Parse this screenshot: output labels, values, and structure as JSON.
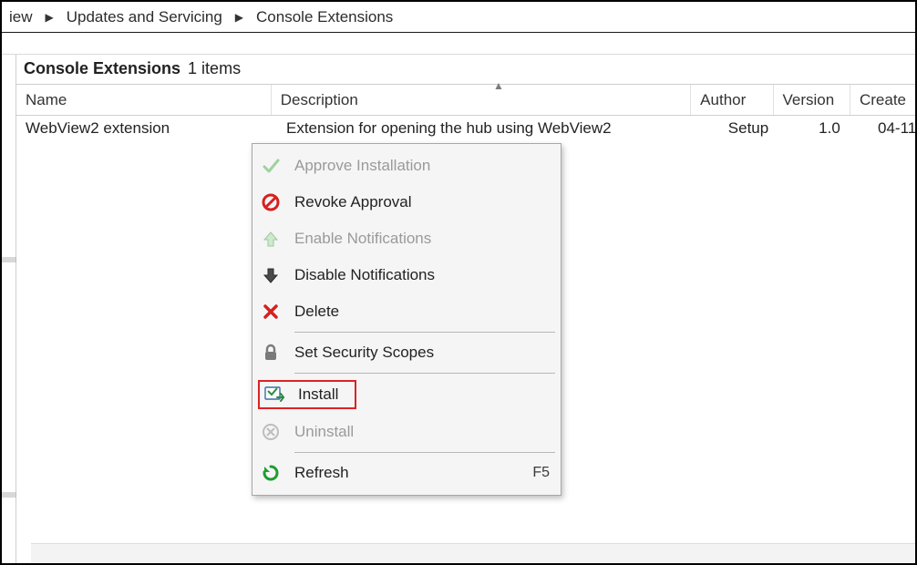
{
  "breadcrumb": {
    "item0": "iew",
    "item1": "Updates and Servicing",
    "item2": "Console Extensions"
  },
  "list": {
    "title": "Console Extensions",
    "count_text": "1 items"
  },
  "columns": {
    "name": "Name",
    "description": "Description",
    "author": "Author",
    "version": "Version",
    "created": "Create"
  },
  "row": {
    "name": "WebView2 extension",
    "description": "Extension for opening the hub using WebView2",
    "author": "Setup",
    "version": "1.0",
    "created": "04-11"
  },
  "menu": {
    "approve": "Approve Installation",
    "revoke": "Revoke Approval",
    "enable_notif": "Enable Notifications",
    "disable_notif": "Disable Notifications",
    "delete": "Delete",
    "security": "Set Security Scopes",
    "install": "Install",
    "uninstall": "Uninstall",
    "refresh": "Refresh",
    "refresh_accel": "F5"
  }
}
